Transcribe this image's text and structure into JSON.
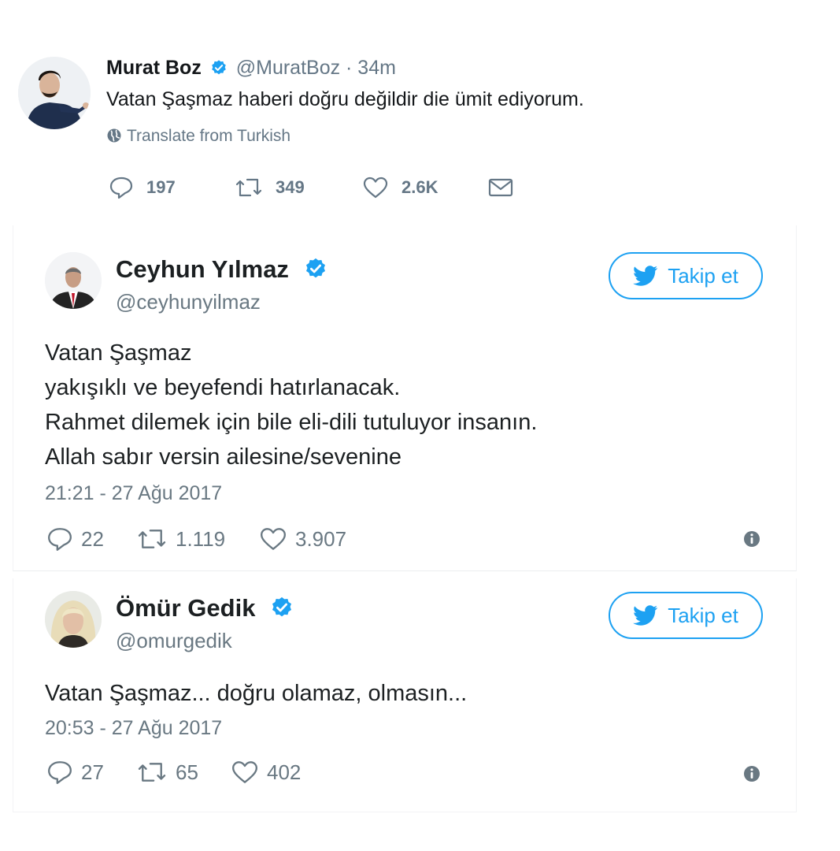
{
  "tweet_main": {
    "name": "Murat Boz",
    "handle": "@MuratBoz · 34m",
    "text": "Vatan Şaşmaz haberi doğru değildir die ümit ediyorum.",
    "translate": "Translate from Turkish",
    "replies": "197",
    "retweets": "349",
    "likes": "2.6K"
  },
  "cards": [
    {
      "name": "Ceyhun Yılmaz",
      "handle": "@ceyhunyilmaz",
      "follow_label": "Takip et",
      "body": [
        "Vatan Şaşmaz",
        "yakışıklı ve beyefendi hatırlanacak.",
        "Rahmet dilemek için bile eli-dili tutuluyor insanın.",
        "Allah sabır versin ailesine/sevenine"
      ],
      "timestamp": "21:21 - 27 Ağu 2017",
      "replies": "22",
      "retweets": "1.119",
      "likes": "3.907"
    },
    {
      "name": "Ömür Gedik",
      "handle": "@omurgedik",
      "follow_label": "Takip et",
      "body": [
        "Vatan Şaşmaz... doğru olamaz, olmasın..."
      ],
      "timestamp": "20:53 - 27 Ağu 2017",
      "replies": "27",
      "retweets": "65",
      "likes": "402"
    }
  ],
  "colors": {
    "accent": "#1da1f2",
    "muted": "#657786",
    "text": "#14171a"
  },
  "icons": [
    "verified-icon",
    "globe-icon",
    "reply-icon",
    "retweet-icon",
    "like-icon",
    "dm-icon",
    "twitter-bird-icon",
    "info-icon"
  ]
}
